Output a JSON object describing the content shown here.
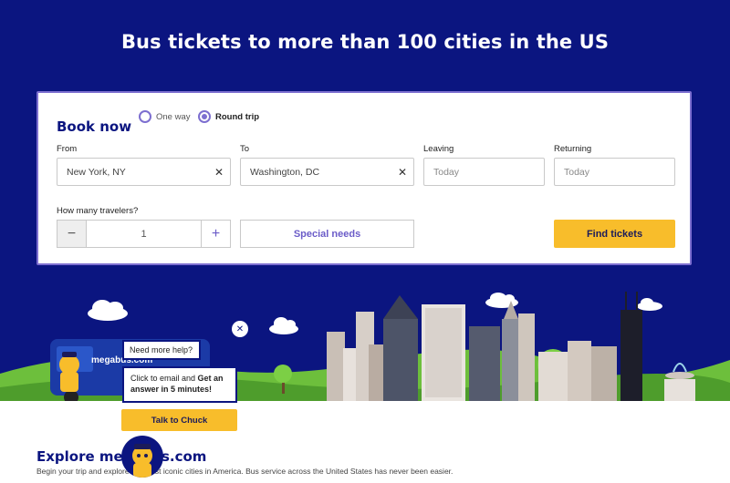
{
  "hero": {
    "title": "Bus tickets to more than 100 cities in the US"
  },
  "booking": {
    "heading": "Book now",
    "trip_type": {
      "one_way": "One way",
      "round_trip": "Round trip",
      "selected": "Round trip"
    },
    "from": {
      "label": "From",
      "value": "New York, NY"
    },
    "to": {
      "label": "To",
      "value": "Washington, DC"
    },
    "leaving": {
      "label": "Leaving",
      "placeholder": "Today"
    },
    "returning": {
      "label": "Returning",
      "placeholder": "Today"
    },
    "travelers": {
      "label": "How many travelers?",
      "value": "1",
      "minus": "−",
      "plus": "+"
    },
    "special_needs": "Special needs",
    "find_tickets": "Find tickets",
    "clear_glyph": "✕"
  },
  "chat": {
    "prompt": "Need more help?",
    "message_prefix": "Click to email and ",
    "message_bold": "Get an answer in 5 minutes!",
    "button": "Talk to Chuck",
    "close_glyph": "✕"
  },
  "bus": {
    "brand": "megabus.com"
  },
  "explore": {
    "title": "Explore megabus.com",
    "subtitle": "Begin your trip and explore the most iconic cities in America. Bus service across the United States has never been easier."
  },
  "colors": {
    "navy": "#0b1580",
    "accent_purple": "#6b5cc8",
    "button_yellow": "#f8bd2b",
    "grass": "#6dbf3c"
  },
  "icons": [
    "clear-icon",
    "chat-close-icon",
    "chuck-mascot-icon"
  ]
}
